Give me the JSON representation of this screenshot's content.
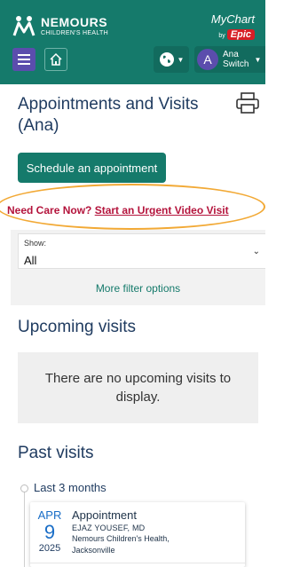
{
  "header": {
    "brand_title": "NEMOURS",
    "brand_subtitle": "CHILDREN'S HEALTH",
    "mychart_name": "MyChart",
    "mychart_by": "by",
    "epic_label": "Epic",
    "avatar_letter": "A",
    "user_name": "Ana",
    "user_switch": "Switch",
    "colors": {
      "header_bg": "#157a6b",
      "menu_bg": "#5b4dad",
      "epic_red": "#d71f26"
    }
  },
  "page": {
    "title": "Appointments and Visits (Ana)",
    "schedule_button": "Schedule an appointment"
  },
  "urgent": {
    "lead": "Need Care Now?",
    "link": "Start an Urgent Video Visit",
    "color": "#b4143c"
  },
  "filters": {
    "show_label": "Show:",
    "show_value": "All",
    "more_filters": "More filter options"
  },
  "upcoming": {
    "title": "Upcoming visits",
    "empty_message": "There are no upcoming visits to display."
  },
  "past": {
    "title": "Past visits",
    "range_label": "Last 3 months",
    "visits": [
      {
        "month": "APR",
        "day": "9",
        "year": "2025",
        "type": "Appointment",
        "provider": "EJAZ YOUSEF, MD",
        "location_line1": "Nemours Children's Health,",
        "location_line2": "Jacksonville"
      }
    ]
  },
  "icons": [
    "menu-icon",
    "home-icon",
    "globe-icon",
    "print-icon",
    "chevron-down-icon"
  ]
}
